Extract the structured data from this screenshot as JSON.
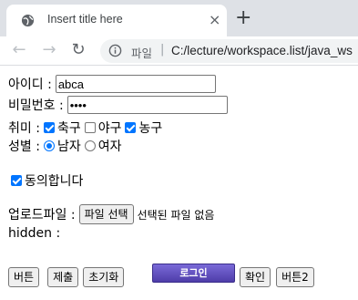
{
  "browser": {
    "tab_title": "Insert title here",
    "tab_close": "×",
    "new_tab": "+",
    "address": {
      "scheme_label": "파일",
      "separator": "|",
      "url": "C:/lecture/workspace.list/java_ws"
    },
    "nav": {
      "back": "←",
      "forward": "→",
      "reload": "↻"
    },
    "icons": [
      "globe-icon",
      "close-icon",
      "plus-icon",
      "back-arrow-icon",
      "forward-arrow-icon",
      "reload-icon",
      "info-icon"
    ]
  },
  "form": {
    "id_label": "아이디 :",
    "id_value": "abca",
    "password_label": "비밀번호 :",
    "password_value": "••••",
    "hobby_label": "취미 :",
    "hobbies": [
      {
        "label": "축구",
        "checked": true
      },
      {
        "label": "야구",
        "checked": false
      },
      {
        "label": "농구",
        "checked": true
      }
    ],
    "gender_label": "성별 :",
    "genders": [
      {
        "label": "남자",
        "selected": true
      },
      {
        "label": "여자",
        "selected": false
      }
    ],
    "agree_label": "동의합니다",
    "agree_checked": true,
    "upload_label": "업로드파일 :",
    "file_button": "파일 선택",
    "file_status": "선택된 파일 없음",
    "hidden_label": "hidden :"
  },
  "buttons": {
    "button": "버튼",
    "submit": "제출",
    "reset": "초기화",
    "login": "로그인",
    "confirm": "확인",
    "button2": "버튼2"
  },
  "colors": {
    "accent": "#0075ff",
    "tabbar_bg": "#dee1e6",
    "login_button": "#5a49b8"
  }
}
